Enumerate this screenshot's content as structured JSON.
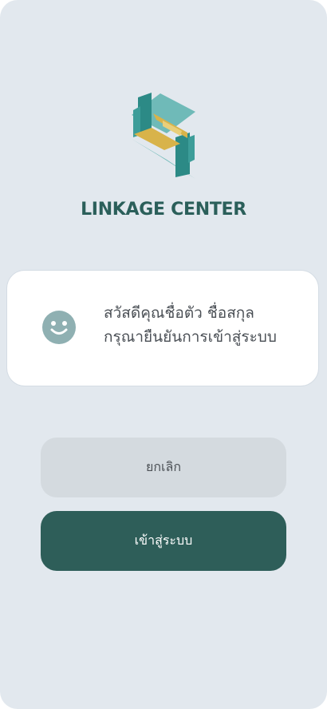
{
  "app": {
    "title": "LINKAGE CENTER",
    "logo_icon": "linkage-center-logo",
    "colors": {
      "background": "#e2e8ee",
      "brand_dark": "#2e5e59",
      "brand_teal": "#5fb0ae",
      "accent_gold": "#d8b34a"
    }
  },
  "greeting": {
    "icon": "smile-icon",
    "line1": "สวัสดีคุณชื่อตัว  ชื่อสกุล",
    "line2": "กรุณายืนยันการเข้าสู่ระบบ"
  },
  "actions": {
    "cancel_label": "ยกเลิก",
    "login_label": "เข้าสู่ระบบ"
  }
}
